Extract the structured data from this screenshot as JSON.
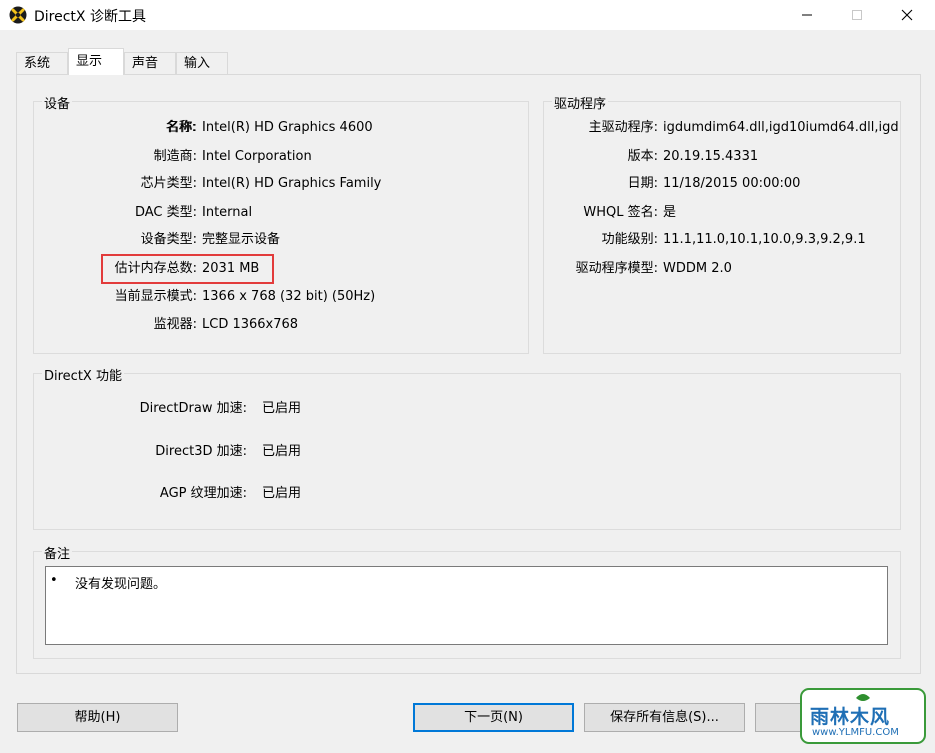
{
  "window": {
    "title": "DirectX 诊断工具"
  },
  "tabs": [
    {
      "label": "系统"
    },
    {
      "label": "显示"
    },
    {
      "label": "声音"
    },
    {
      "label": "输入"
    }
  ],
  "device": {
    "title": "设备",
    "rows": [
      {
        "label": "名称:",
        "value": "Intel(R) HD Graphics 4600"
      },
      {
        "label": "制造商:",
        "value": "Intel Corporation"
      },
      {
        "label": "芯片类型:",
        "value": "Intel(R) HD Graphics Family"
      },
      {
        "label": "DAC 类型:",
        "value": "Internal"
      },
      {
        "label": "设备类型:",
        "value": "完整显示设备"
      },
      {
        "label": "估计内存总数:",
        "value": "2031 MB"
      },
      {
        "label": "当前显示模式:",
        "value": "1366 x 768 (32 bit) (50Hz)"
      },
      {
        "label": "监视器:",
        "value": "LCD 1366x768"
      }
    ]
  },
  "driver": {
    "title": "驱动程序",
    "rows": [
      {
        "label": "主驱动程序:",
        "value": "igdumdim64.dll,igd10iumd64.dll,igd"
      },
      {
        "label": "版本:",
        "value": "20.19.15.4331"
      },
      {
        "label": "日期:",
        "value": "11/18/2015 00:00:00"
      },
      {
        "label": "WHQL 签名:",
        "value": "是"
      },
      {
        "label": "功能级别:",
        "value": "11.1,11.0,10.1,10.0,9.3,9.2,9.1"
      },
      {
        "label": "驱动程序模型:",
        "value": "WDDM 2.0"
      }
    ]
  },
  "directx_features": {
    "title": "DirectX 功能",
    "rows": [
      {
        "label": "DirectDraw 加速:",
        "value": "已启用"
      },
      {
        "label": "Direct3D 加速:",
        "value": "已启用"
      },
      {
        "label": "AGP 纹理加速:",
        "value": "已启用"
      }
    ]
  },
  "notes": {
    "title": "备注",
    "bullet": "•",
    "items": [
      "没有发现问题。"
    ]
  },
  "buttons": {
    "help": "帮助(H)",
    "next": "下一页(N)",
    "save_all": "保存所有信息(S)..."
  },
  "watermark": {
    "brand": "雨林木风",
    "url": "www.YLMFU.COM"
  },
  "colors": {
    "highlight": "#e23b3b",
    "primary_border": "#0078d7"
  }
}
